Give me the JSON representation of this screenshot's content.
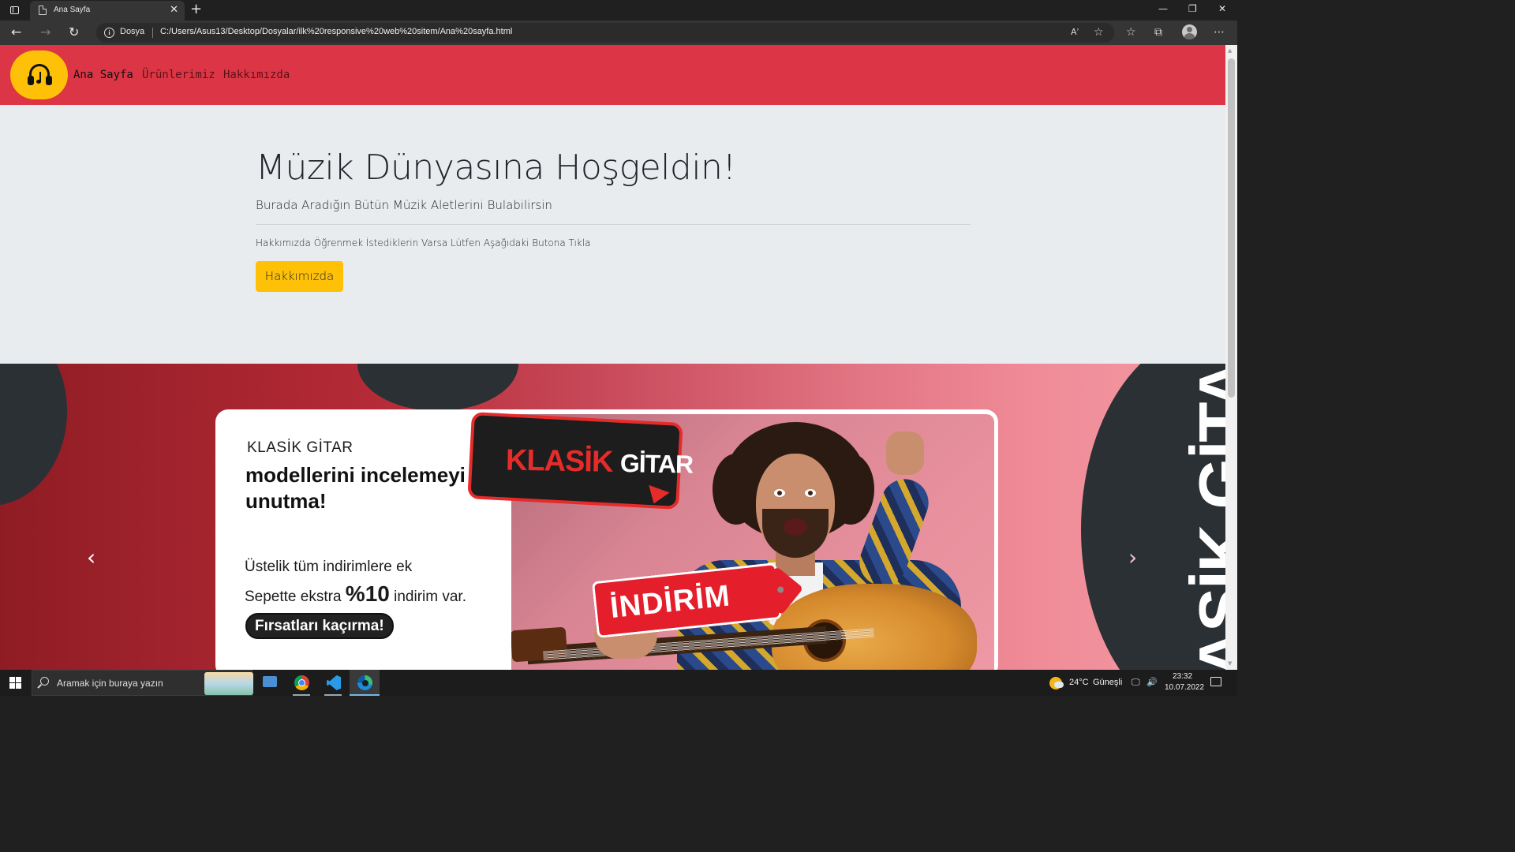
{
  "browser": {
    "tab_title": "Ana Sayfa",
    "tab_close": "✕",
    "new_tab": "+",
    "window_controls": {
      "minimize": "—",
      "restore": "❐",
      "close": "✕"
    },
    "nav": {
      "back": "←",
      "forward": "→",
      "reload": "↻"
    },
    "address": {
      "info_glyph": "i",
      "scheme_label": "Dosya",
      "url": "C:/Users/Asus13/Desktop/Dosyalar/ilk%20responsive%20web%20sitem/Ana%20sayfa.html"
    },
    "toolbar": {
      "read_aloud": "Aʾ",
      "add_favorite": "☆",
      "favorites": "☆",
      "collections": "⧉",
      "more": "⋯"
    }
  },
  "site": {
    "nav": {
      "items": [
        {
          "label": "Ana Sayfa",
          "active": true
        },
        {
          "label": "Ürünlerimiz",
          "active": false
        },
        {
          "label": "Hakkımızda",
          "active": false
        }
      ]
    },
    "jumbotron": {
      "title": "Müzik Dünyasına Hoşgeldin!",
      "lead": "Burada Aradığın Bütün Müzik Aletlerini Bulabilirsin",
      "text": "Hakkımızda Öğrenmek İstediklerin Varsa Lütfen Aşağıdaki Butona Tıkla",
      "button_label": "Hakkımızda"
    },
    "carousel": {
      "kicker": "KLASİK GİTAR",
      "headline": "modellerini incelemeyi unutma!",
      "offer_line1": "Üstelik tüm indirimlere ek",
      "offer_line2_prefix": "Sepette ekstra ",
      "offer_percent": "%10",
      "offer_line2_suffix": " indirim var.",
      "cta": "Fırsatları kaçırma!",
      "bubble_red": "KLASİK",
      "bubble_white": "GİTAR",
      "tag_text": "İNDİRİM",
      "vertical_text": "ASİK GİTAR",
      "prev_glyph": "‹",
      "next_glyph": "›"
    },
    "colors": {
      "navbar": "#dc3545",
      "accent": "#ffc107",
      "jumbotron_bg": "#e9ecef"
    }
  },
  "taskbar": {
    "search_placeholder": "Aramak için buraya yazın",
    "apps": [
      "desktop-app",
      "chrome",
      "vscode",
      "edge"
    ],
    "weather": {
      "temp": "24°C",
      "condition": "Güneşli"
    },
    "time": "23:32",
    "date": "10.07.2022"
  }
}
